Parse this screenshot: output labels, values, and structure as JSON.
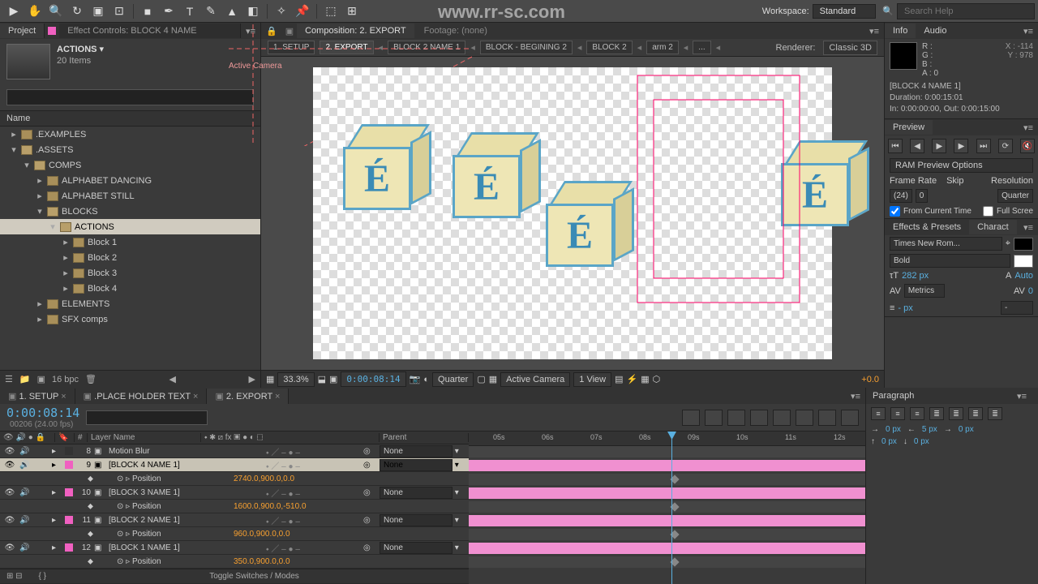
{
  "topbar": {
    "workspace_label": "Workspace:",
    "workspace_value": "Standard",
    "search_placeholder": "Search Help",
    "watermark": "www.rr-sc.com"
  },
  "project": {
    "tab_project": "Project",
    "tab_effects": "Effect Controls: BLOCK 4 NAME",
    "name": "ACTIONS",
    "items": "20 Items",
    "col_name": "Name",
    "tree": [
      {
        "indent": 0,
        "label": ".EXAMPLES",
        "open": false
      },
      {
        "indent": 0,
        "label": ".ASSETS",
        "open": true
      },
      {
        "indent": 1,
        "label": "COMPS",
        "open": true
      },
      {
        "indent": 2,
        "label": "ALPHABET DANCING",
        "open": false
      },
      {
        "indent": 2,
        "label": "ALPHABET STILL",
        "open": false
      },
      {
        "indent": 2,
        "label": "BLOCKS",
        "open": true
      },
      {
        "indent": 3,
        "label": "ACTIONS",
        "open": true,
        "sel": true
      },
      {
        "indent": 4,
        "label": "Block 1",
        "open": false
      },
      {
        "indent": 4,
        "label": "Block 2",
        "open": false
      },
      {
        "indent": 4,
        "label": "Block 3",
        "open": false
      },
      {
        "indent": 4,
        "label": "Block 4",
        "open": false
      },
      {
        "indent": 2,
        "label": "ELEMENTS",
        "open": false
      },
      {
        "indent": 2,
        "label": "SFX comps",
        "open": false
      }
    ],
    "bpc": "16 bpc"
  },
  "comp": {
    "tab_label": "Composition: 2. EXPORT",
    "tab_footage": "Footage: (none)",
    "flow": [
      "1. SETUP",
      "2. EXPORT",
      "BLOCK 2 NAME 1",
      "BLOCK - BEGINING 2",
      "BLOCK 2",
      "arm 2",
      "..."
    ],
    "flow_active": 1,
    "renderer_label": "Renderer:",
    "renderer_value": "Classic 3D",
    "active_camera": "Active Camera",
    "block_letter": "É",
    "foot": {
      "zoom": "33.3%",
      "time": "0:00:08:14",
      "quality": "Quarter",
      "camera": "Active Camera",
      "view": "1 View",
      "exposure": "+0.0"
    }
  },
  "info": {
    "tab_info": "Info",
    "tab_audio": "Audio",
    "r": "R :",
    "g": "G :",
    "b": "B :",
    "a": "A : 0",
    "x": "X : -114",
    "y": "Y : 978",
    "name": "[BLOCK 4 NAME 1]",
    "dur": "Duration: 0:00:15:01",
    "inout": "In: 0:00:00:00, Out: 0:00:15:00"
  },
  "preview": {
    "tab": "Preview",
    "options": "RAM Preview Options",
    "framerate_label": "Frame Rate",
    "skip_label": "Skip",
    "resolution_label": "Resolution",
    "framerate": "(24)",
    "skip": "0",
    "quarter": "Quarter",
    "from_current": "From Current Time",
    "full_screen": "Full Scree"
  },
  "effects": {
    "tab_ep": "Effects & Presets",
    "tab_char": "Charact"
  },
  "character": {
    "font": "Times New Rom...",
    "weight": "Bold",
    "size": "282 px",
    "leading": "Auto",
    "tracking_mode": "Metrics",
    "tracking2": "0",
    "stroke_size": "- px",
    "stroke_mode": "-"
  },
  "paragraph": {
    "tab": "Paragraph",
    "v1": "0 px",
    "v2": "5 px",
    "v3": "0 px",
    "v4": "0 px",
    "v5": "0 px"
  },
  "timeline": {
    "tabs": [
      "1. SETUP",
      ".PLACE HOLDER TEXT",
      "2. EXPORT"
    ],
    "active_tab": 2,
    "time": "0:00:08:14",
    "sub": "00206 (24.00 fps)",
    "col_layer": "Layer Name",
    "col_parent": "Parent",
    "toggle": "Toggle Switches / Modes",
    "ruler": [
      "05s",
      "06s",
      "07s",
      "08s",
      "09s",
      "10s",
      "11s",
      "12s"
    ],
    "parent_none": "None",
    "rows": [
      {
        "num": "8",
        "name": "Motion Blur",
        "color": "#333"
      },
      {
        "num": "9",
        "name": "[BLOCK 4 NAME 1]",
        "color": "#f060c0",
        "sel": true
      },
      {
        "prop": "Position",
        "val": "2740.0,900.0,0.0"
      },
      {
        "num": "10",
        "name": "[BLOCK 3 NAME 1]",
        "color": "#f060c0"
      },
      {
        "prop": "Position",
        "val": "1600.0,900.0,-510.0"
      },
      {
        "num": "11",
        "name": "[BLOCK 2 NAME 1]",
        "color": "#f060c0"
      },
      {
        "prop": "Position",
        "val": "960.0,900.0,0.0"
      },
      {
        "num": "12",
        "name": "[BLOCK 1 NAME 1]",
        "color": "#f060c0"
      },
      {
        "prop": "Position",
        "val": "350.0,900.0,0.0"
      }
    ]
  }
}
